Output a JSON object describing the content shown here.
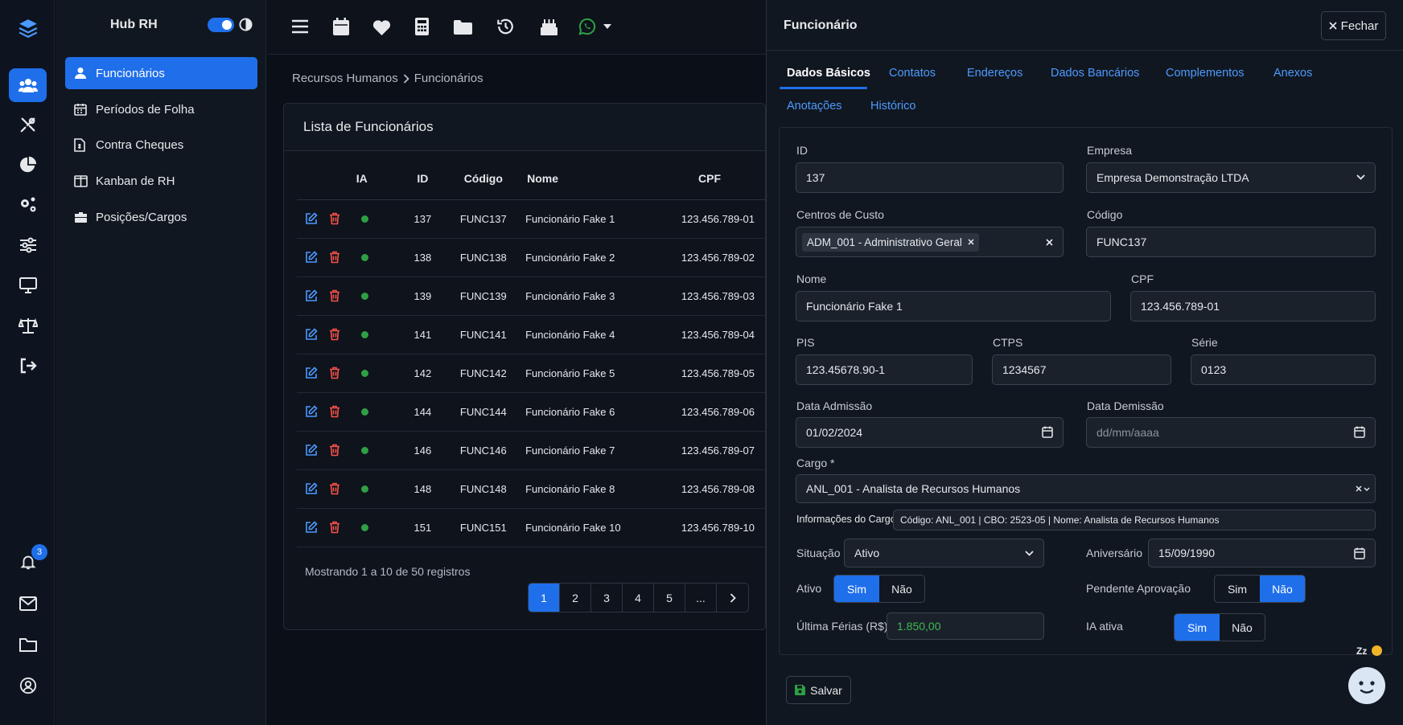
{
  "app": {
    "title": "Hub RH"
  },
  "rail": {
    "notification_count": "3"
  },
  "sidebar": {
    "items": [
      {
        "label": "Funcionários"
      },
      {
        "label": "Períodos de Folha"
      },
      {
        "label": "Contra Cheques"
      },
      {
        "label": "Kanban de RH"
      },
      {
        "label": "Posições/Cargos"
      }
    ]
  },
  "breadcrumb": {
    "parent": "Recursos Humanos",
    "current": "Funcionários"
  },
  "list": {
    "title": "Lista de Funcionários",
    "columns": [
      "IA",
      "ID",
      "Código",
      "Nome",
      "CPF"
    ],
    "rows": [
      {
        "id": "137",
        "code": "FUNC137",
        "name": "Funcionário Fake 1",
        "cpf": "123.456.789-01"
      },
      {
        "id": "138",
        "code": "FUNC138",
        "name": "Funcionário Fake 2",
        "cpf": "123.456.789-02"
      },
      {
        "id": "139",
        "code": "FUNC139",
        "name": "Funcionário Fake 3",
        "cpf": "123.456.789-03"
      },
      {
        "id": "141",
        "code": "FUNC141",
        "name": "Funcionário Fake 4",
        "cpf": "123.456.789-04"
      },
      {
        "id": "142",
        "code": "FUNC142",
        "name": "Funcionário Fake 5",
        "cpf": "123.456.789-05"
      },
      {
        "id": "144",
        "code": "FUNC144",
        "name": "Funcionário Fake 6",
        "cpf": "123.456.789-06"
      },
      {
        "id": "146",
        "code": "FUNC146",
        "name": "Funcionário Fake 7",
        "cpf": "123.456.789-07"
      },
      {
        "id": "148",
        "code": "FUNC148",
        "name": "Funcionário Fake 8",
        "cpf": "123.456.789-08"
      },
      {
        "id": "151",
        "code": "FUNC151",
        "name": "Funcionário Fake 10",
        "cpf": "123.456.789-10"
      }
    ],
    "footer": "Mostrando 1 a 10 de 50 registros",
    "pages": [
      "1",
      "2",
      "3",
      "4",
      "5",
      "..."
    ]
  },
  "panel": {
    "title": "Funcionário",
    "close_label": "Fechar",
    "tabs": [
      "Dados Básicos",
      "Contatos",
      "Endereços",
      "Dados Bancários",
      "Complementos",
      "Anexos",
      "Anotações",
      "Histórico"
    ],
    "fields": {
      "id": {
        "label": "ID",
        "value": "137"
      },
      "empresa": {
        "label": "Empresa",
        "value": "Empresa Demonstração LTDA"
      },
      "centros": {
        "label": "Centros de Custo",
        "value": "ADM_001 - Administrativo Geral"
      },
      "codigo": {
        "label": "Código",
        "value": "FUNC137"
      },
      "nome": {
        "label": "Nome",
        "value": "Funcionário Fake 1"
      },
      "cpf": {
        "label": "CPF",
        "value": "123.456.789-01"
      },
      "pis": {
        "label": "PIS",
        "value": "123.45678.90-1"
      },
      "ctps": {
        "label": "CTPS",
        "value": "1234567"
      },
      "serie": {
        "label": "Série",
        "value": "0123"
      },
      "admissao": {
        "label": "Data Admissão",
        "value": "01/02/2024"
      },
      "demissao": {
        "label": "Data Demissão",
        "placeholder": "dd/mm/aaaa"
      },
      "cargo": {
        "label": "Cargo *",
        "value": "ANL_001 - Analista de Recursos Humanos"
      },
      "info_cargo": {
        "label": "Informações do Cargo",
        "value": "Código: ANL_001 | CBO: 2523-05 | Nome: Analista de Recursos Humanos"
      },
      "situacao": {
        "label": "Situação",
        "value": "Ativo"
      },
      "aniversario": {
        "label": "Aniversário",
        "value": "15/09/1990"
      },
      "ativo": {
        "label": "Ativo",
        "yes": "Sim",
        "no": "Não",
        "selected": "Sim"
      },
      "pendente": {
        "label": "Pendente Aprovação",
        "yes": "Sim",
        "no": "Não",
        "selected": "Não"
      },
      "ferias": {
        "label": "Última Férias (R$)",
        "value": "1.850,00"
      },
      "ia": {
        "label": "IA ativa",
        "yes": "Sim",
        "no": "Não",
        "selected": "Sim"
      }
    },
    "save_label": "Salvar"
  },
  "status": {
    "sleep": "Zz"
  },
  "colors": {
    "accent": "#1f6feb",
    "danger": "#f85149",
    "success": "#2ea043",
    "link": "#4c9aff"
  }
}
